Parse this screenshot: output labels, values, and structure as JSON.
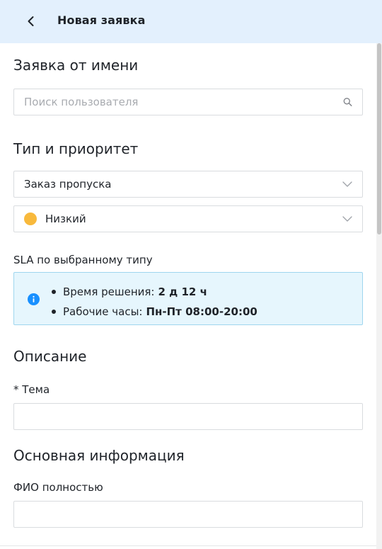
{
  "header": {
    "title": "Новая заявка",
    "back_icon": "chevron-left-icon"
  },
  "requester": {
    "section_title": "Заявка от имени",
    "search": {
      "placeholder": "Поиск пользователя",
      "value": "",
      "icon": "search-icon"
    }
  },
  "type_priority": {
    "section_title": "Тип и приоритет",
    "type_select": {
      "value": "Заказ пропуска",
      "icon": "chevron-down-icon"
    },
    "priority_select": {
      "value": "Низкий",
      "dot_color": "#f8b93c",
      "icon": "chevron-down-icon"
    }
  },
  "sla": {
    "label": "SLA по выбранному типу",
    "icon": "info-icon",
    "items": [
      {
        "label": "Время решения:",
        "value": "2 д 12 ч"
      },
      {
        "label": "Рабочие часы:",
        "value": "Пн-Пт 08:00-20:00"
      }
    ]
  },
  "description": {
    "section_title": "Описание",
    "topic": {
      "label": "* Тема",
      "value": ""
    }
  },
  "main_info": {
    "section_title": "Основная информация",
    "full_name": {
      "label": "ФИО полностью",
      "value": ""
    }
  },
  "colors": {
    "header_bg": "#e3f0fd",
    "sla_bg": "#e6f6fd",
    "sla_border": "#9fd6ef",
    "info_blue": "#1890ff",
    "priority_low": "#f8b93c"
  }
}
